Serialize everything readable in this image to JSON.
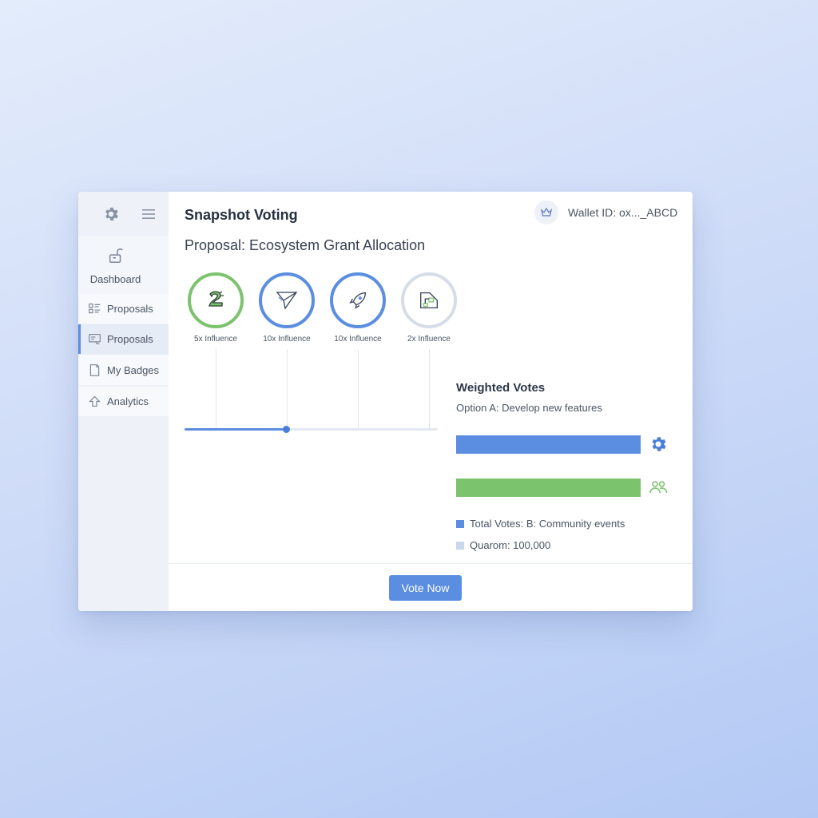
{
  "app": {
    "title": "Snapshot Voting"
  },
  "wallet": {
    "icon": "crown-icon",
    "text": "Wallet ID: ox..._ABCD"
  },
  "sidebar": {
    "top_icons": [
      "gear-icon",
      "menu-icon"
    ],
    "dashboard": {
      "label": "Dashboard",
      "icon": "unlock-icon"
    },
    "items": [
      {
        "label": "Proposals",
        "icon": "grid-list-icon",
        "active": false
      },
      {
        "label": "Proposals",
        "icon": "form-icon",
        "active": true
      },
      {
        "label": "My Badges",
        "icon": "badge-icon",
        "active": false
      },
      {
        "label": "Analytics",
        "icon": "arrow-up-icon",
        "active": false
      }
    ]
  },
  "proposal": {
    "title": "Proposal: Ecosystem Grant Allocation"
  },
  "badges": [
    {
      "label": "5x Influence",
      "icon": "dragon-icon",
      "ring_color": "#7cc36e"
    },
    {
      "label": "10x Influence",
      "icon": "paper-plane-icon",
      "ring_color": "#5b8de0"
    },
    {
      "label": "10x Influence",
      "icon": "rocket-icon",
      "ring_color": "#5b8de0"
    },
    {
      "label": "2x Influence",
      "icon": "network-icon",
      "ring_color": "#d6dde8"
    }
  ],
  "slider": {
    "value_fraction": 0.4
  },
  "weighted_votes": {
    "title": "Weighted Votes",
    "option_label": "Option A: Develop new features",
    "bars": [
      {
        "fraction": 1.0,
        "color": "#5b8de0",
        "icon": "gear-icon"
      },
      {
        "fraction": 1.0,
        "color": "#7cc36e",
        "icon": "users-icon"
      }
    ],
    "legend": [
      {
        "text": "Total Votes: B: Community events",
        "color": "#5b8de0"
      },
      {
        "text": "Quarom: 100,000",
        "color": "#c9d8ec"
      }
    ]
  },
  "actions": {
    "vote_label": "Vote Now"
  },
  "colors": {
    "accent": "#5b8de0",
    "green": "#7cc36e",
    "sidebar_bg": "#eef2f8"
  }
}
